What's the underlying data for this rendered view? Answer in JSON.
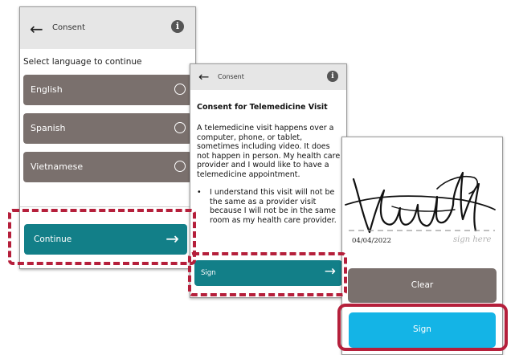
{
  "screen1": {
    "header_title": "Consent",
    "back_icon": "←",
    "info_icon": "i",
    "prompt": "Select language to continue",
    "languages": [
      "English",
      "Spanish",
      "Vietnamese"
    ],
    "continue_label": "Continue",
    "continue_arrow": "→"
  },
  "screen2": {
    "header_title": "Consent",
    "back_icon": "←",
    "info_icon": "i",
    "heading": "Consent for Telemedicine Visit",
    "paragraph": "A telemedicine visit happens over a computer, phone, or tablet, sometimes including video. It does not happen in person. My health care provider and I would like to have a telemedicine appointment.",
    "bullet": "I understand this visit will not be the same as a provider visit because I will not be in the same room as my health care provider.",
    "sign_label": "Sign",
    "sign_arrow": "→"
  },
  "screen3": {
    "date": "04/04/2022",
    "sign_here": "sign here",
    "clear_label": "Clear",
    "sign_label": "Sign"
  },
  "colors": {
    "teal": "#127f88",
    "taupe": "#7a706d",
    "cyan": "#14b4e6",
    "highlight": "#b51f3b"
  }
}
